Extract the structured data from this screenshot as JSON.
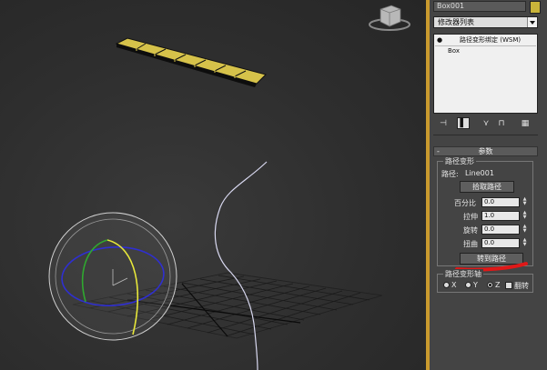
{
  "object_name": "Box001",
  "object_color": "#c9b43a",
  "modifier_list_label": "修改器列表",
  "modifier_stack": [
    {
      "label": "路径变形绑定 (WSM)",
      "selected": true
    },
    {
      "label": "Box",
      "selected": false
    }
  ],
  "rollout_title": "参数",
  "group_title": "路径变形",
  "path_label": "路径:",
  "path_value": "Line001",
  "pick_path_label": "拾取路径",
  "params": [
    {
      "label": "百分比",
      "value": "0.0"
    },
    {
      "label": "拉伸",
      "value": "1.0"
    },
    {
      "label": "旋转",
      "value": "0.0"
    },
    {
      "label": "扭曲",
      "value": "0.0"
    }
  ],
  "move_to_path_label": "转到路径",
  "axis_group_title": "路径变形轴",
  "axes": [
    {
      "label": "X",
      "selected": false
    },
    {
      "label": "Y",
      "selected": false
    },
    {
      "label": "Z",
      "selected": true
    }
  ],
  "flip_label": "翻转",
  "toolbar_icons": [
    "pin-stack-icon",
    "show-end-result-icon",
    "make-unique-icon",
    "remove-modifier-icon",
    "configure-modifier-sets-icon"
  ],
  "colors": {
    "accent": "#c99a2e",
    "box_gold": "#c9b43a",
    "annotation_red": "#e01818"
  }
}
